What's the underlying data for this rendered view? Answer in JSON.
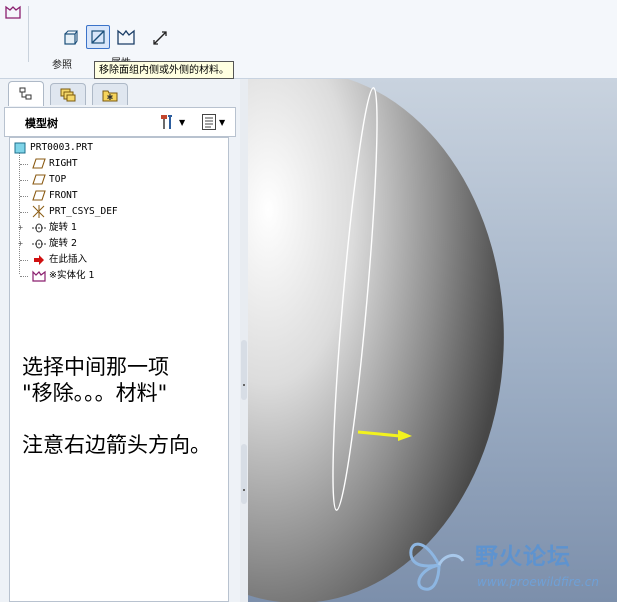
{
  "dashboard": {
    "references_label": "参照",
    "properties_label": "属性",
    "tooltip": "移除面组内侧或外侧的材料。"
  },
  "tabs": [
    "model-tree",
    "layers",
    "favorites"
  ],
  "tree": {
    "title": "模型树",
    "nodes": [
      {
        "label": "PRT0003.PRT",
        "icon": "part-icon"
      },
      {
        "label": "RIGHT",
        "icon": "datum-plane-icon"
      },
      {
        "label": "TOP",
        "icon": "datum-plane-icon"
      },
      {
        "label": "FRONT",
        "icon": "datum-plane-icon"
      },
      {
        "label": "PRT_CSYS_DEF",
        "icon": "csys-icon"
      },
      {
        "label": "旋转 1",
        "icon": "revolve-icon"
      },
      {
        "label": "旋转 2",
        "icon": "revolve-icon"
      },
      {
        "label": "在此插入",
        "icon": "insert-arrow-icon"
      },
      {
        "label": "※实体化 1",
        "icon": "solidify-icon"
      }
    ]
  },
  "annotation": "选择中间那一项\n\"移除。。。材料\"\n\n注意右边箭头方向。",
  "watermark": {
    "name": "野火论坛",
    "url": "www.proewildfire.cn"
  },
  "colors": {
    "view_top": "#c9d3df",
    "view_bottom": "#7c8fab",
    "arrow": "#f2f21e",
    "feature_icon": "#8a1f6e"
  }
}
